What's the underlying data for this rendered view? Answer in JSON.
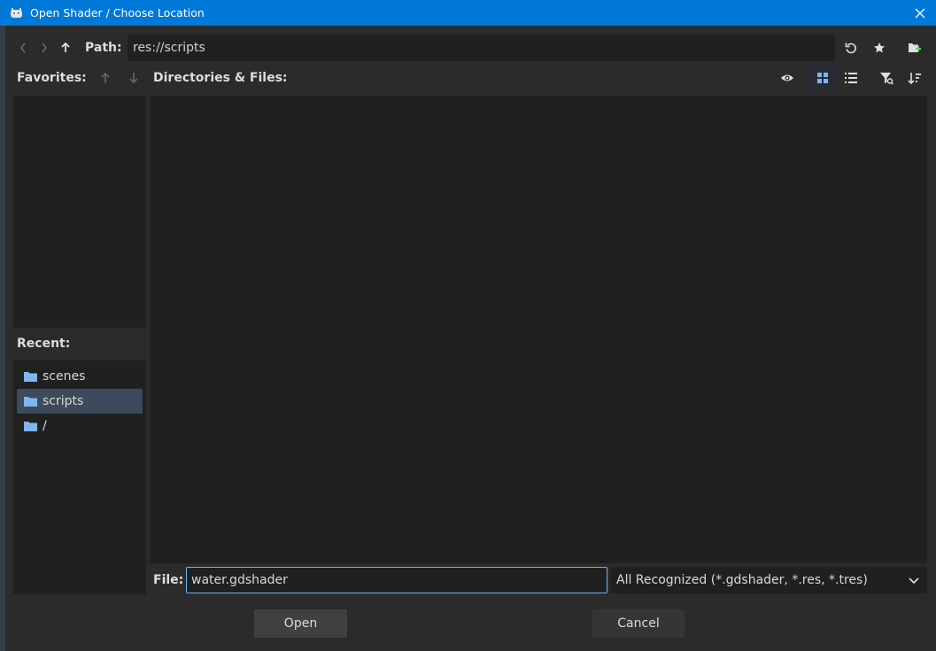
{
  "window": {
    "title": "Open Shader / Choose Location"
  },
  "pathbar": {
    "path_label": "Path:",
    "path_value": "res://scripts"
  },
  "labels": {
    "favorites": "Favorites:",
    "directories_files": "Directories & Files:",
    "recent": "Recent:"
  },
  "recent": {
    "items": [
      {
        "label": "scenes",
        "selected": false
      },
      {
        "label": "scripts",
        "selected": true
      },
      {
        "label": "/",
        "selected": false
      }
    ]
  },
  "filebar": {
    "file_label": "File:",
    "file_value": "water.gdshader",
    "filter_value": "All Recognized (*.gdshader, *.res, *.tres)"
  },
  "buttons": {
    "open": "Open",
    "cancel": "Cancel"
  },
  "colors": {
    "titlebar": "#0078d7",
    "accent": "#6ab0f5",
    "panel": "#202020",
    "background": "#2b2b2b",
    "selection": "#3d4a5c"
  },
  "icons": [
    "godot-icon",
    "close-icon",
    "chevron-left-icon",
    "chevron-right-icon",
    "arrow-up-icon",
    "reload-icon",
    "star-icon",
    "new-folder-icon",
    "move-up-icon",
    "move-down-icon",
    "eye-icon",
    "grid-view-icon",
    "list-view-icon",
    "filter-icon",
    "sort-icon",
    "folder-icon",
    "chevron-down-icon"
  ]
}
